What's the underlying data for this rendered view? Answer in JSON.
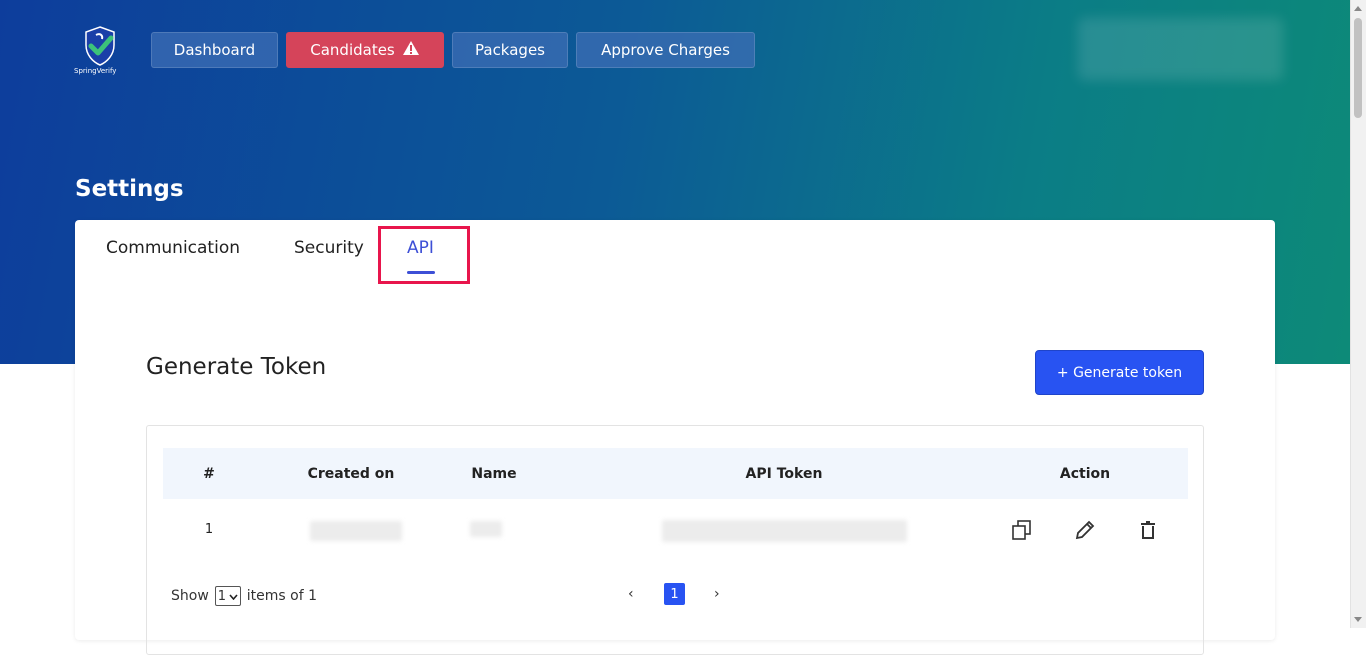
{
  "header": {
    "logo_text": "SpringVerify",
    "nav": [
      {
        "label": "Dashboard"
      },
      {
        "label": "Candidates",
        "icon": "warning-icon"
      },
      {
        "label": "Packages"
      },
      {
        "label": "Approve Charges"
      }
    ]
  },
  "page": {
    "title": "Settings",
    "tabs": [
      {
        "label": "Communication"
      },
      {
        "label": "Security"
      },
      {
        "label": "API",
        "active": true
      }
    ]
  },
  "generate": {
    "title": "Generate Token",
    "button_label": "+ Generate token"
  },
  "table": {
    "columns": [
      "#",
      "Created on",
      "Name",
      "API Token",
      "Action"
    ],
    "rows": [
      {
        "index": "1",
        "actions": [
          "copy-icon",
          "edit-icon",
          "delete-icon"
        ]
      }
    ]
  },
  "pagination": {
    "show_label": "Show",
    "page_size": "1",
    "items_label": "items of 1",
    "prev": "‹",
    "next": "›",
    "current_page": "1"
  },
  "colors": {
    "primary": "#2853f2",
    "danger": "#d5445a",
    "active_tab": "#3d4fd6",
    "highlight": "#e8154c"
  }
}
